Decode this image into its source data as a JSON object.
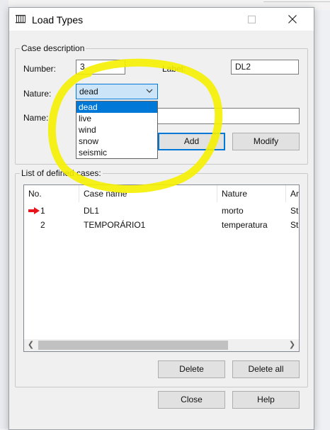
{
  "window": {
    "title": "Load Types"
  },
  "case_description": {
    "group_title": "Case description",
    "number_label": "Number:",
    "number_value": "3",
    "label_label": "Label:",
    "label_value": "DL2",
    "nature_label": "Nature:",
    "nature_selected": "dead",
    "nature_options": [
      "dead",
      "live",
      "wind",
      "snow",
      "seismic"
    ],
    "name_label": "Name:",
    "name_value": "",
    "add_label": "Add",
    "modify_label": "Modify"
  },
  "defined_cases": {
    "group_title": "List of defined cases:",
    "columns": [
      "No.",
      "Case name",
      "Nature",
      "Ar"
    ],
    "rows": [
      {
        "no": "1",
        "name": "DL1",
        "nature": "morto",
        "extra": "St",
        "current": true
      },
      {
        "no": "2",
        "name": "TEMPORÁRIO1",
        "nature": "temperatura",
        "extra": "St",
        "current": false
      }
    ],
    "delete_label": "Delete",
    "delete_all_label": "Delete all"
  },
  "footer": {
    "close_label": "Close",
    "help_label": "Help"
  },
  "colors": {
    "accent": "#0078d7",
    "annotation": "#f4f000",
    "current_arrow": "#e8141b"
  }
}
